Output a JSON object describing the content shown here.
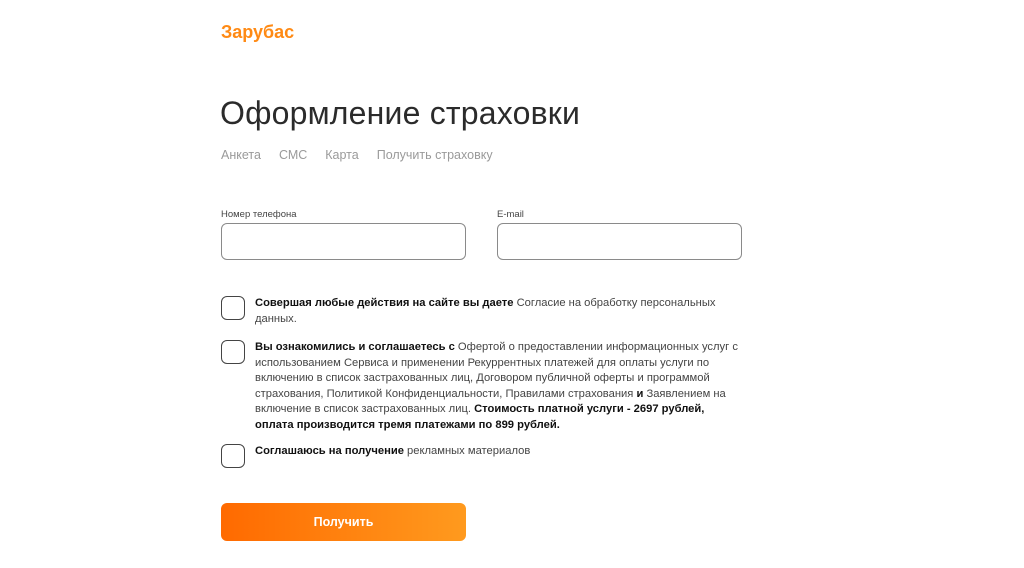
{
  "brand": {
    "name": "Зарубас",
    "color": "#ff8a14"
  },
  "page": {
    "title": "Оформление страховки"
  },
  "steps": [
    "Анкета",
    "СМС",
    "Карта",
    "Получить страховку"
  ],
  "form": {
    "phone_label": "Номер телефона",
    "phone_value": "",
    "email_label": "E-mail",
    "email_value": ""
  },
  "checkboxes": [
    {
      "checked": false,
      "bold1": "Совершая любые действия на сайте вы даете",
      "text1": " Согласие на обработку персональных данных."
    },
    {
      "checked": false,
      "bold1": "Вы ознакомились и соглашаетесь с",
      "text1": " Офертой о предоставлении информационных услуг с использованием Сервиса и применении Рекуррентных платежей для оплаты услуги по включению в список застрахованных лиц, Договором публичной оферты и программой страхования, Политикой Конфиденциальности, Правилами страхования",
      "bold2": " и ",
      "text2": "Заявлением на включение в список застрахованных лиц.",
      "bold3": " Стоимость платной услуги - 2697 рублей, оплата производится тремя платежами по 899 рублей."
    },
    {
      "checked": false,
      "bold1": "Соглашаюсь на получение",
      "text1": " рекламных материалов"
    }
  ],
  "submit_label": "Получить",
  "colors": {
    "accent_start": "#ff6a00",
    "accent_end": "#ff9a1e"
  }
}
